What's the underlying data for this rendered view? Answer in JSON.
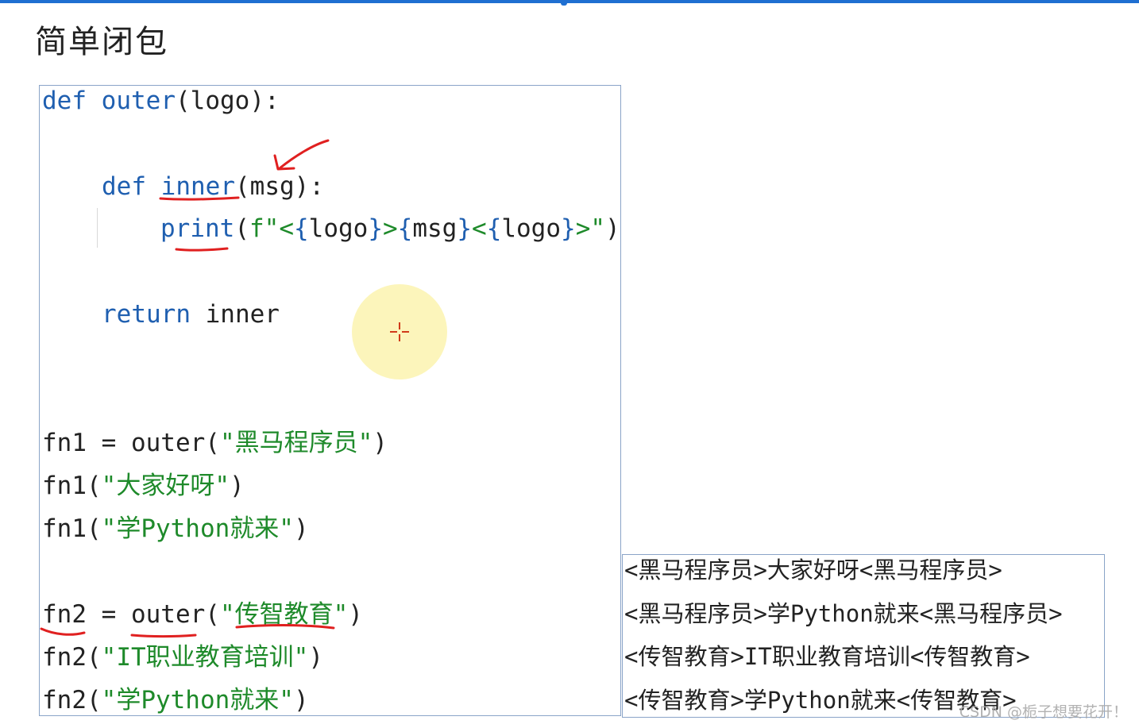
{
  "slide": {
    "title": "简单闭包"
  },
  "code": {
    "l1_def": "def",
    "l1_name": "outer",
    "l1_rest": "(logo):",
    "l2_def": "def",
    "l2_name": "inner",
    "l2_rest": "(msg):",
    "l3_print": "print",
    "l3_open": "(",
    "l3_f": "f\"<",
    "l3_b1": "{",
    "l3_v1": "logo",
    "l3_b2": "}",
    "l3_s1": ">",
    "l3_b3": "{",
    "l3_v2": "msg",
    "l3_b4": "}",
    "l3_s2": "<",
    "l3_b5": "{",
    "l3_v3": "logo",
    "l3_b6": "}",
    "l3_s3": ">\"",
    "l3_close": ")",
    "l4_return": "return",
    "l4_rest": " inner",
    "l5_pre": "fn1 = outer(",
    "l5_str": "\"黑马程序员\"",
    "l5_post": ")",
    "l6_pre": "fn1(",
    "l6_str": "\"大家好呀\"",
    "l6_post": ")",
    "l7_pre": "fn1(",
    "l7_str": "\"学Python就来\"",
    "l7_post": ")",
    "l8_pre": "fn2 = outer(",
    "l8_str": "\"传智教育\"",
    "l8_post": ")",
    "l9_pre": "fn2(",
    "l9_str": "\"IT职业教育培训\"",
    "l9_post": ")",
    "l10_pre": "fn2(",
    "l10_str": "\"学Python就来\"",
    "l10_post": ")"
  },
  "output": {
    "lines": [
      "<黑马程序员>大家好呀<黑马程序员>",
      "<黑马程序员>学Python就来<黑马程序员>",
      "<传智教育>IT职业教育培训<传智教育>",
      "<传智教育>学Python就来<传智教育>"
    ]
  },
  "watermark": "CSDN @栀子想要花开！",
  "colors": {
    "keyword": "#1f5fb0",
    "string": "#1e8a2a",
    "annotation": "#e02020",
    "box_border": "#8aa4c8",
    "top_bar": "#1f6fd1"
  },
  "icons": {
    "cursor": "crosshair-cursor-icon"
  }
}
